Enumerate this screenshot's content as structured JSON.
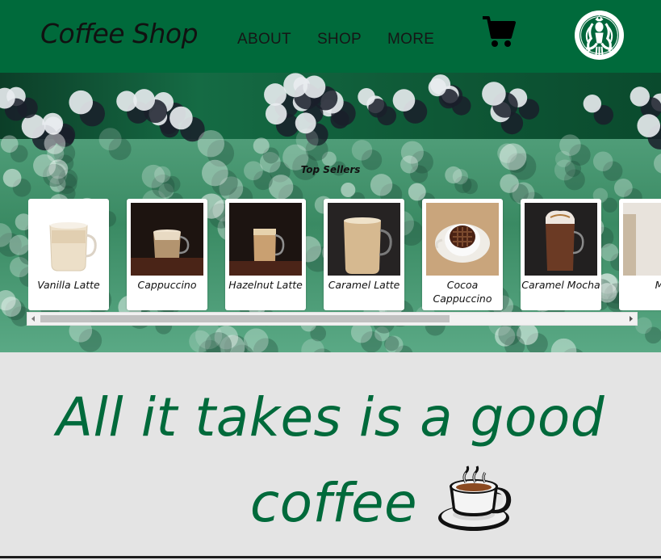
{
  "header": {
    "brand": "Coffee Shop",
    "nav": [
      "ABOUT",
      "SHOP",
      "MORE"
    ],
    "cart_icon": "shopping-cart-icon",
    "logo": "siren-logo"
  },
  "hero": {
    "heading": "Top Sellers",
    "products": [
      {
        "name": "Vanilla Latte",
        "drink": "latte",
        "bg": "#ffffff"
      },
      {
        "name": "Cappuccino",
        "drink": "cappuccino",
        "bg": "#1d1410"
      },
      {
        "name": "Hazelnut Latte",
        "drink": "latte-dark",
        "bg": "#1c1411"
      },
      {
        "name": "Caramel Latte",
        "drink": "latte-glass",
        "bg": "#262323"
      },
      {
        "name": "Cocoa Cappuccino",
        "drink": "cocoa",
        "bg": "#c9a57c"
      },
      {
        "name": "Caramel Mocha",
        "drink": "mocha",
        "bg": "#222020"
      },
      {
        "name": "M",
        "drink": "partial",
        "bg": "#e8e3dc"
      }
    ]
  },
  "tagline": {
    "line1": "All it takes is a good",
    "line2": "coffee",
    "emoji_icon": "hot-beverage-icon"
  },
  "colors": {
    "brand_green": "#006a3b",
    "page_bg": "#e4e4e4"
  }
}
